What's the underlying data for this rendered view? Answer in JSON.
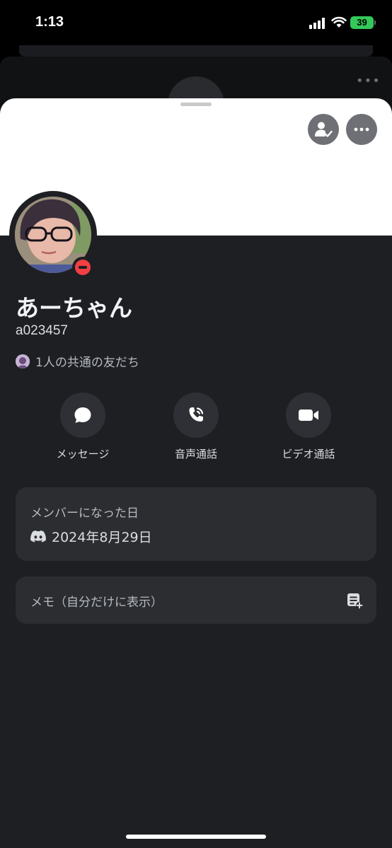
{
  "status_bar": {
    "time": "1:13",
    "battery": "39"
  },
  "profile": {
    "display_name": "あーちゃん",
    "username": "a023457",
    "mutual_friends": "1人の共通の友だち"
  },
  "actions": [
    {
      "label": "メッセージ",
      "icon": "chat-bubble-icon"
    },
    {
      "label": "音声通話",
      "icon": "phone-call-icon"
    },
    {
      "label": "ビデオ通話",
      "icon": "video-camera-icon"
    }
  ],
  "member_card": {
    "title": "メンバーになった日",
    "date": "2024年8月29日",
    "icon": "discord-logo-icon"
  },
  "memo": {
    "placeholder": "メモ（自分だけに表示）",
    "icon": "add-note-icon"
  },
  "colors": {
    "dnd_status": "#f23f43",
    "battery": "#34c759",
    "banner": "#ffffff",
    "sheet": "#1e1f23",
    "card": "#2b2d31"
  }
}
